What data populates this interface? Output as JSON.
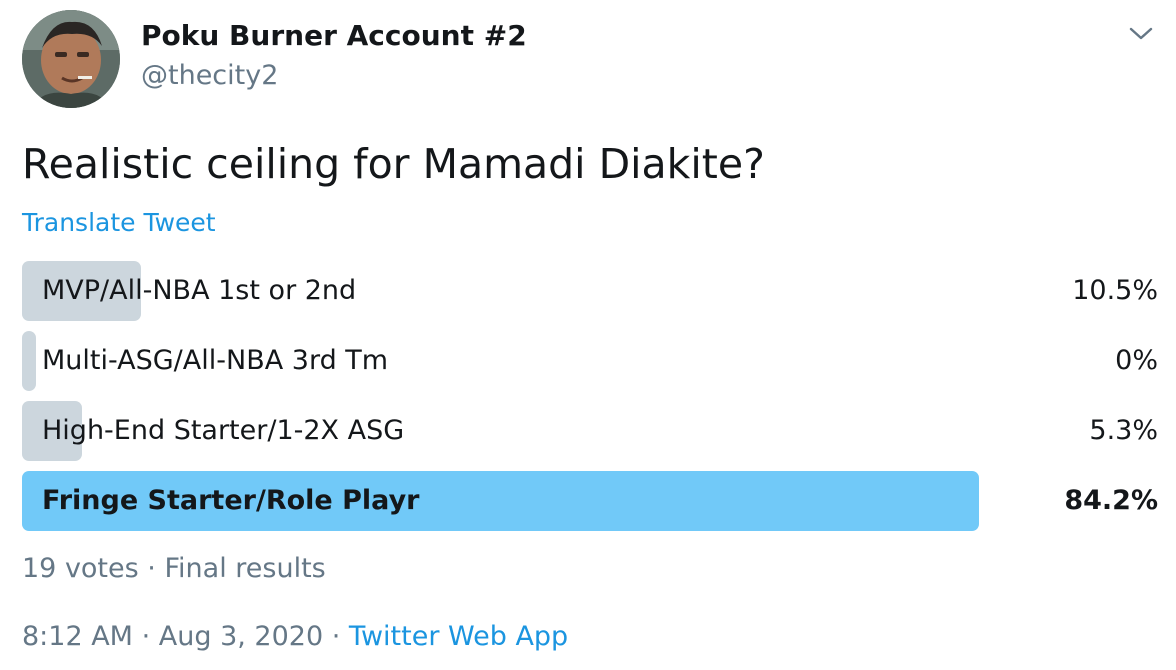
{
  "author": {
    "display_name": "Poku Burner Account #2",
    "handle": "@thecity2",
    "avatar_icon": "profile-photo"
  },
  "menu_icon": "chevron-down-icon",
  "tweet": {
    "text": "Realistic ceiling for Mamadi Diakite?",
    "translate_label": "Translate Tweet"
  },
  "poll": {
    "options": [
      {
        "label": "MVP/All-NBA 1st or 2nd",
        "percent_label": "10.5%",
        "percent": 10.5,
        "winner": false
      },
      {
        "label": "Multi-ASG/All-NBA 3rd Tm",
        "percent_label": "0%",
        "percent": 0,
        "winner": false
      },
      {
        "label": "High-End Starter/1-2X ASG",
        "percent_label": "5.3%",
        "percent": 5.3,
        "winner": false
      },
      {
        "label": "Fringe Starter/Role Playr",
        "percent_label": "84.2%",
        "percent": 84.2,
        "winner": true
      }
    ],
    "votes": "19 votes",
    "separator": "·",
    "status": "Final results"
  },
  "meta": {
    "time": "8:12 AM",
    "separator": "·",
    "date": "Aug 3, 2020",
    "source": "Twitter Web App"
  },
  "colors": {
    "bar": "#ccd6dd",
    "winner_bar": "#71c9f8",
    "link": "#1b95e0",
    "secondary_text": "#657786"
  }
}
